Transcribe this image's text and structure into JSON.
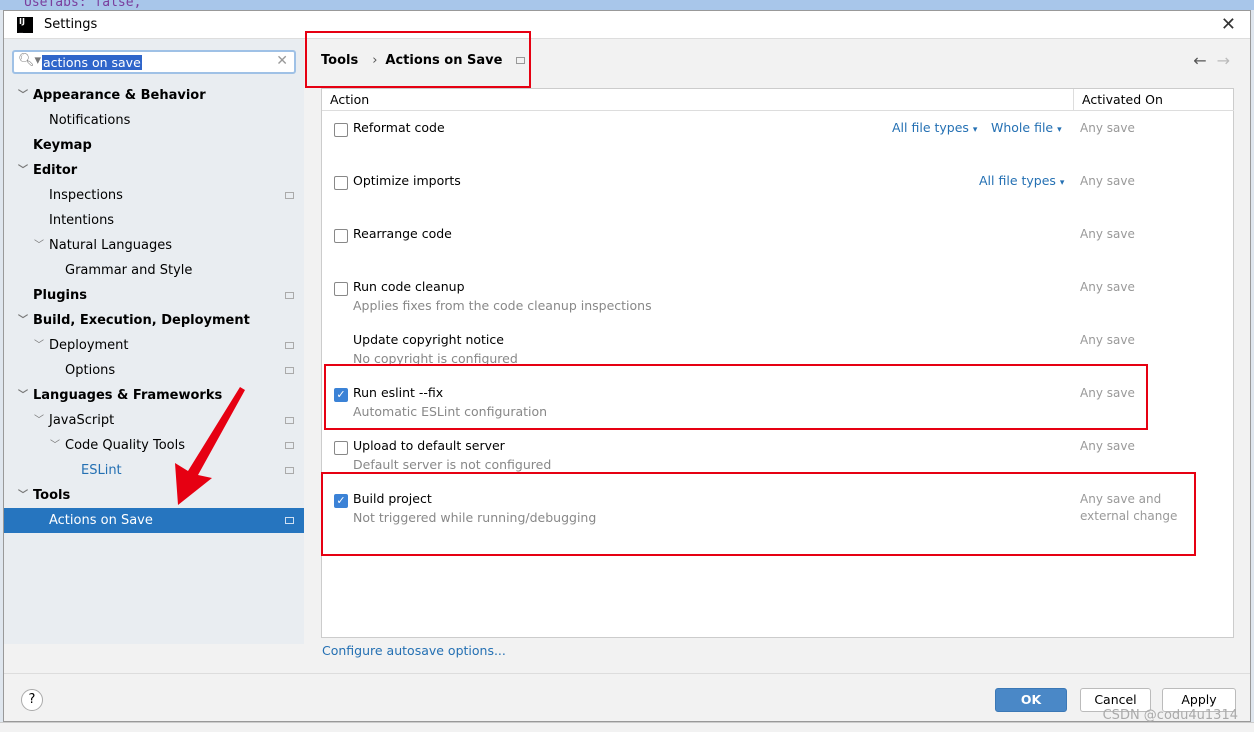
{
  "background_code": "UseTabs: false,",
  "window": {
    "title": "Settings",
    "logo": "IJ"
  },
  "search": {
    "value": "actions on save"
  },
  "tree": [
    {
      "label": "Appearance & Behavior",
      "bold": true,
      "level": 0,
      "expanded": true
    },
    {
      "label": "Notifications",
      "level": 1
    },
    {
      "label": "Keymap",
      "bold": true,
      "level": 0
    },
    {
      "label": "Editor",
      "bold": true,
      "level": 0,
      "expanded": true
    },
    {
      "label": "Inspections",
      "level": 1,
      "page": true
    },
    {
      "label": "Intentions",
      "level": 1
    },
    {
      "label": "Natural Languages",
      "level": 1,
      "expanded": true
    },
    {
      "label": "Grammar and Style",
      "level": 2
    },
    {
      "label": "Plugins",
      "bold": true,
      "level": 0,
      "page": true
    },
    {
      "label": "Build, Execution, Deployment",
      "bold": true,
      "level": 0,
      "expanded": true
    },
    {
      "label": "Deployment",
      "level": 1,
      "expanded": true,
      "page": true
    },
    {
      "label": "Options",
      "level": 2,
      "page": true
    },
    {
      "label": "Languages & Frameworks",
      "bold": true,
      "level": 0,
      "expanded": true
    },
    {
      "label": "JavaScript",
      "level": 1,
      "expanded": true,
      "page": true
    },
    {
      "label": "Code Quality Tools",
      "level": 2,
      "expanded": true,
      "page": true
    },
    {
      "label": "ESLint",
      "level": 3,
      "link": true,
      "page": true
    },
    {
      "label": "Tools",
      "bold": true,
      "level": 0,
      "expanded": true
    },
    {
      "label": "Actions on Save",
      "level": 1,
      "selected": true,
      "page": true
    }
  ],
  "breadcrumb": {
    "parent": "Tools",
    "current": "Actions on Save"
  },
  "table": {
    "headers": [
      "Action",
      "Activated On"
    ],
    "rows": [
      {
        "title": "Reformat code",
        "checked": false,
        "dropdowns": [
          "All file types",
          "Whole file"
        ],
        "activated": "Any save"
      },
      {
        "title": "Optimize imports",
        "checked": false,
        "dropdowns": [
          "All file types"
        ],
        "activated": "Any save"
      },
      {
        "title": "Rearrange code",
        "checked": false,
        "activated": "Any save"
      },
      {
        "title": "Run code cleanup",
        "checked": false,
        "subtitle": "Applies fixes from the code cleanup inspections",
        "activated": "Any save"
      },
      {
        "title": "Update copyright notice",
        "nocheck": true,
        "subtitle": "No copyright is configured",
        "activated": "Any save"
      },
      {
        "title": "Run eslint --fix",
        "checked": true,
        "subtitle": "Automatic ESLint configuration",
        "activated": "Any save"
      },
      {
        "title": "Upload to default server",
        "checked": false,
        "subtitle": "Default server is not configured",
        "activated": "Any save"
      },
      {
        "title": "Build project",
        "checked": true,
        "subtitle": "Not triggered while running/debugging",
        "activated": "Any save and external change"
      }
    ]
  },
  "configure_link": "Configure autosave options...",
  "footer": {
    "help": "?",
    "ok": "OK",
    "cancel": "Cancel",
    "apply": "Apply"
  },
  "watermark": "CSDN @codu4u1314",
  "colors": {
    "accent": "#2675bf",
    "annotation": "#e60012",
    "link": "#2470b3"
  }
}
